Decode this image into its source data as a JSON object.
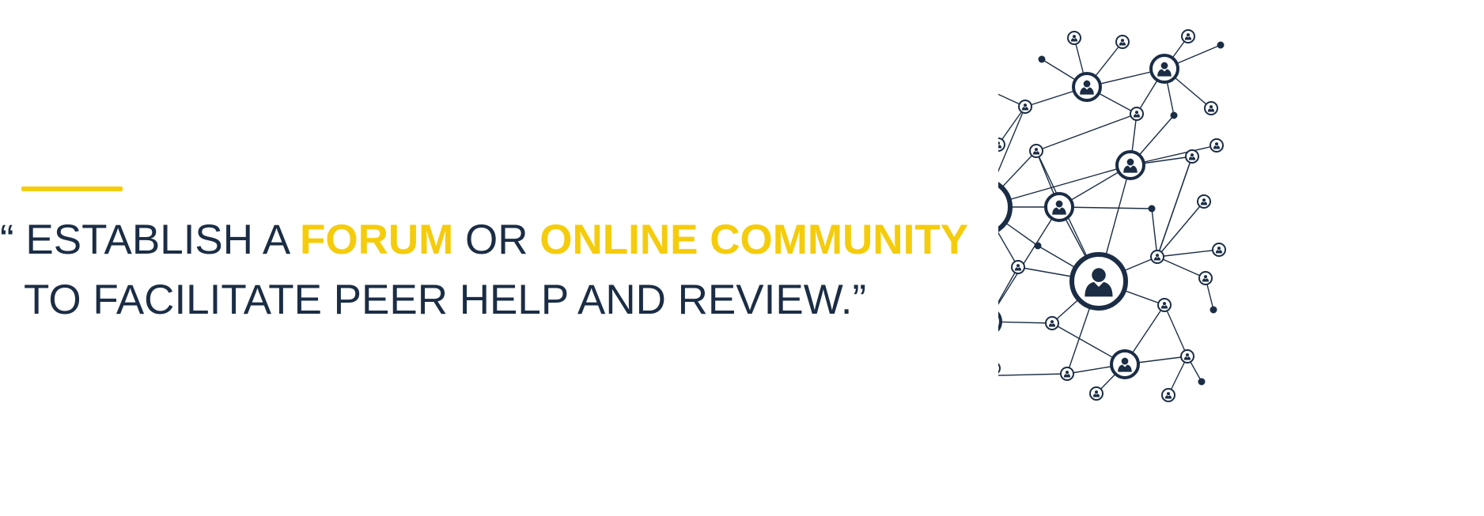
{
  "quote": {
    "open_mark": "“ ",
    "line1_a": "ESTABLISH A ",
    "highlight1": "FORUM",
    "line1_b": " OR ",
    "highlight2": "ONLINE COMMUNITY",
    "line2": "TO FACILITATE PEER HELP AND REVIEW.”"
  },
  "illustration": {
    "icon": "people-network-icon"
  },
  "colors": {
    "navy": "#1b2d45",
    "accent": "#f5cc0c",
    "background": "#ffffff"
  }
}
